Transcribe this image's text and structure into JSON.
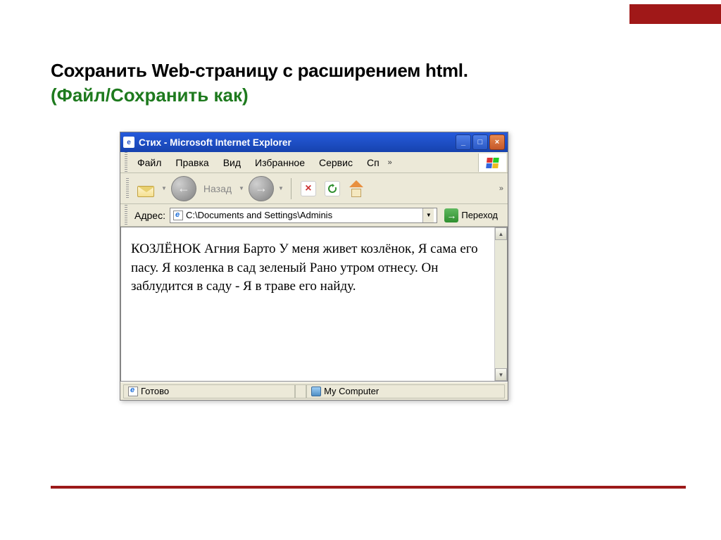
{
  "slide": {
    "title_main": "Сохранить  Web-страницу с расширением html.",
    "title_sub": "(Файл/Сохранить как)"
  },
  "window": {
    "title": "Стих - Microsoft Internet Explorer",
    "menu": {
      "file": "Файл",
      "edit": "Правка",
      "view": "Вид",
      "favorites": "Избранное",
      "tools": "Сервис",
      "partial": "Сп"
    },
    "toolbar": {
      "back_label": "Назад"
    },
    "addressbar": {
      "label": "Адрес:",
      "path": "C:\\Documents and Settings\\Adminis",
      "go": "Переход"
    },
    "content_text": "КОЗЛЁНОК Агния Барто У меня живет козлёнок, Я сама его пасу. Я козленка в сад зеленый Рано утром отнесу. Он заблудится в саду - Я в траве его найду.",
    "status": {
      "ready": "Готово",
      "zone": "My Computer"
    }
  }
}
